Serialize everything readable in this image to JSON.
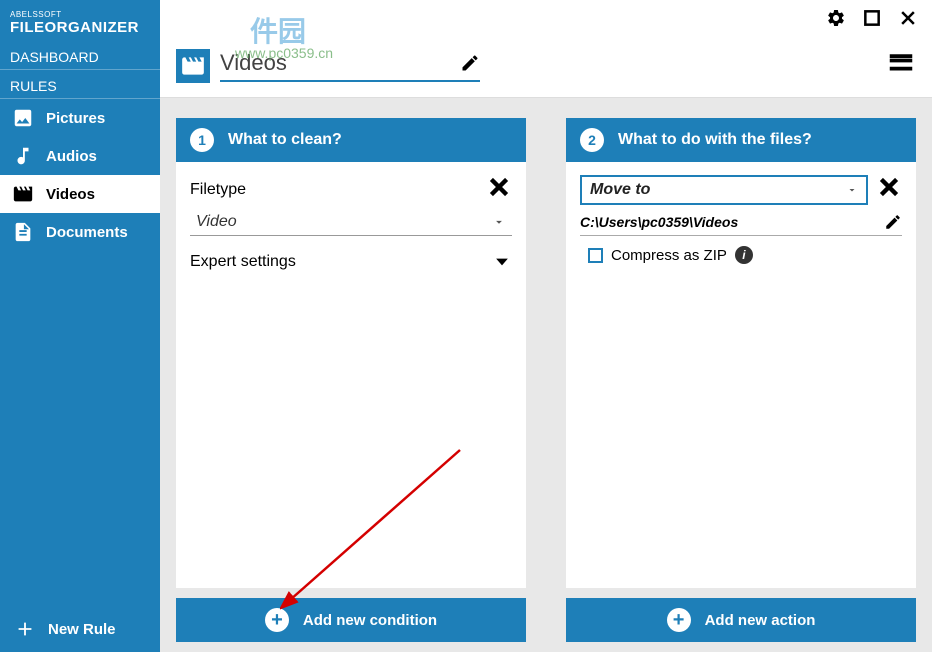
{
  "app": {
    "brand_small": "ABELSSOFT",
    "brand_big": "FILEORGANIZER"
  },
  "watermark": {
    "text": "件园",
    "url": "www.pc0359.cn"
  },
  "sidebar": {
    "dashboard_label": "DASHBOARD",
    "rules_label": "RULES",
    "items": [
      {
        "label": "Pictures"
      },
      {
        "label": "Audios"
      },
      {
        "label": "Videos"
      },
      {
        "label": "Documents"
      }
    ],
    "new_rule_label": "New Rule"
  },
  "header": {
    "title": "Videos"
  },
  "panel1": {
    "step": "1",
    "title": "What to clean?",
    "filetype_label": "Filetype",
    "filetype_value": "Video",
    "expert_label": "Expert settings"
  },
  "panel2": {
    "step": "2",
    "title": "What to do with the files?",
    "action_value": "Move to",
    "path_value": "C:\\Users\\pc0359\\Videos",
    "compress_label": "Compress as ZIP"
  },
  "footer": {
    "add_condition": "Add new condition",
    "add_action": "Add new action"
  }
}
